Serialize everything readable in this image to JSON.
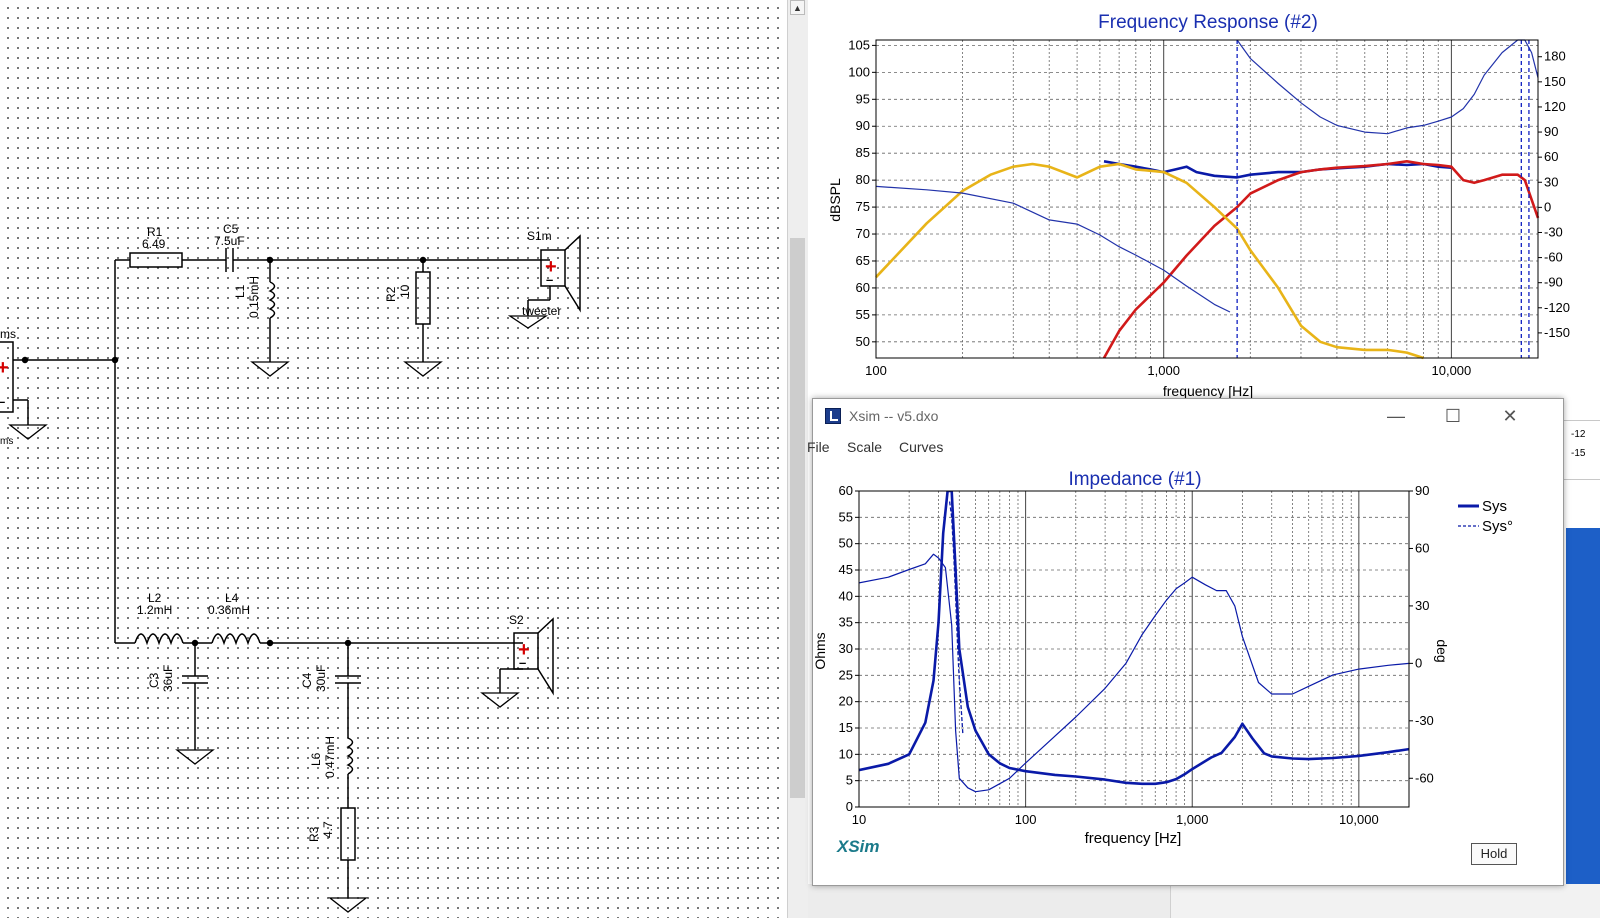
{
  "schematic": {
    "components": {
      "r1": {
        "ref": "R1",
        "value": "6.49"
      },
      "c5": {
        "ref": "C5",
        "value": "7.5uF"
      },
      "l1": {
        "ref": "L1",
        "value": "0.15mH"
      },
      "r2": {
        "ref": "R2",
        "value": "10"
      },
      "s1m": {
        "ref": "S1m",
        "label": "tweeter"
      },
      "l2": {
        "ref": "L2",
        "value": "1.2mH"
      },
      "l4": {
        "ref": "L4",
        "value": "0.36mH"
      },
      "c3": {
        "ref": "C3",
        "value": "36uF"
      },
      "c4": {
        "ref": "C4",
        "value": "30uF"
      },
      "l6": {
        "ref": "L6",
        "value": "0.47mH"
      },
      "r3": {
        "ref": "R3",
        "value": "4.7"
      },
      "s2": {
        "ref": "S2"
      }
    },
    "source_label_top": "ms",
    "source_label_bottom": "ms",
    "plus_sign": "+",
    "minus_sign": "–"
  },
  "scrollbar": {
    "up_arrow": "▲"
  },
  "frequency_response": {
    "title": "Frequency Response (#2)",
    "ylabel": "dBSPL",
    "xlabel": "frequency [Hz]",
    "y_ticks": [
      "105",
      "100",
      "95",
      "90",
      "85",
      "80",
      "75",
      "70",
      "65",
      "60",
      "55",
      "50"
    ],
    "y2_ticks": [
      "180",
      "150",
      "120",
      "90",
      "60",
      "30",
      "0",
      "-30",
      "-60",
      "-90",
      "-120",
      "-150"
    ],
    "x_ticks": [
      "100",
      "1,000",
      "10,000"
    ],
    "colors": {
      "system": "#0a1aa8",
      "tweeter": "#d11a1a",
      "woofer": "#e8b418",
      "phase": "#2233aa"
    }
  },
  "window": {
    "title": "Xsim -- v5.dxo",
    "icon": "xsim-app-icon",
    "minimize_icon": "minimize-icon",
    "maximize_icon": "maximize-icon",
    "close_icon": "close-icon",
    "minimize_glyph": "—",
    "maximize_glyph": "☐",
    "close_glyph": "✕",
    "menu": [
      "File",
      "Scale",
      "Curves"
    ]
  },
  "impedance": {
    "title": "Impedance (#1)",
    "ylabel": "Ohms",
    "y2label": "deg",
    "xlabel": "frequency [Hz]",
    "y_ticks": [
      "60",
      "55",
      "50",
      "45",
      "40",
      "35",
      "30",
      "25",
      "20",
      "15",
      "10",
      "5",
      "0"
    ],
    "y2_ticks": [
      "90",
      "60",
      "30",
      "0",
      "-30",
      "-60"
    ],
    "x_ticks": [
      "10",
      "100",
      "1,000",
      "10,000"
    ],
    "legend": [
      {
        "name": "Sys",
        "style": "solid"
      },
      {
        "name": "Sys°",
        "style": "dashed"
      }
    ],
    "brand": "XSim",
    "hold_button": "Hold"
  },
  "peek_labels": [
    "-12",
    "-15"
  ],
  "chart_data": [
    {
      "type": "line",
      "title": "Frequency Response (#2)",
      "xlabel": "frequency [Hz]",
      "ylabel": "dBSPL",
      "x_scale": "log",
      "xlim": [
        100,
        20000
      ],
      "ylim": [
        47,
        106
      ],
      "y2lim": [
        -180,
        200
      ],
      "grid": true,
      "series": [
        {
          "role": "system",
          "color": "#0a1aa8",
          "x": [
            620,
            700,
            800,
            900,
            1000,
            1100,
            1200,
            1300,
            1500,
            1800,
            2000,
            2500,
            3000,
            3500,
            4000,
            5000,
            6000,
            7000,
            8000,
            9000,
            10000
          ],
          "y": [
            83.5,
            83,
            82.5,
            82,
            81.5,
            82,
            82.5,
            81.5,
            80.8,
            80.5,
            81,
            81.5,
            81.5,
            82,
            82.2,
            82.5,
            83,
            82.8,
            83,
            82.5,
            82.3
          ]
        },
        {
          "role": "tweeter",
          "color": "#d11a1a",
          "x": [
            620,
            700,
            800,
            1000,
            1200,
            1500,
            1800,
            2000,
            2500,
            3000,
            3500,
            4000,
            5000,
            6000,
            7000,
            8000,
            9000,
            10000,
            11000,
            12000,
            13000,
            15000,
            17000,
            18000,
            20000
          ],
          "y": [
            47,
            52,
            56,
            61,
            66,
            71.5,
            75,
            77.5,
            80,
            81.5,
            82,
            82.3,
            82.6,
            83,
            83.5,
            83,
            82.8,
            82.5,
            80,
            79.5,
            80,
            81,
            81,
            80,
            73
          ]
        },
        {
          "role": "woofer",
          "color": "#e8b418",
          "x": [
            100,
            150,
            200,
            250,
            300,
            350,
            400,
            500,
            600,
            700,
            800,
            1000,
            1200,
            1500,
            1800,
            2000,
            2500,
            3000,
            3500,
            4000,
            5000,
            6000,
            7000,
            8000
          ],
          "y": [
            62,
            72,
            78,
            81,
            82.5,
            83,
            82.5,
            80.5,
            82.5,
            83,
            82,
            81.5,
            79.5,
            75,
            71,
            67,
            60,
            53,
            50,
            49,
            48.5,
            48.5,
            48,
            46.5
          ]
        },
        {
          "role": "phase",
          "style": "thin",
          "color": "#2233aa",
          "x": [
            100,
            150,
            200,
            300,
            400,
            500,
            600,
            700,
            800,
            1000,
            1200,
            1500,
            1700
          ],
          "y2": [
            25,
            21,
            17,
            5,
            -15,
            -20,
            -33,
            -47,
            -57,
            -75,
            -94,
            -116,
            -125
          ]
        },
        {
          "role": "phase",
          "style": "thin",
          "color": "#2233aa",
          "x": [
            1800,
            2000,
            2500,
            3000,
            3500,
            4000,
            5000,
            6000,
            7000,
            8000,
            9000,
            10000,
            11000,
            12000,
            13000,
            15000,
            17000,
            18000,
            19000,
            20000
          ],
          "y2": [
            200,
            178,
            148,
            125,
            108,
            98,
            90,
            88,
            95,
            98,
            103,
            108,
            118,
            135,
            158,
            185,
            200,
            200,
            185,
            155
          ]
        }
      ]
    },
    {
      "type": "line",
      "title": "Impedance (#1)",
      "xlabel": "frequency [Hz]",
      "ylabel": "Ohms",
      "y2label": "deg",
      "x_scale": "log",
      "xlim": [
        10,
        20000
      ],
      "ylim": [
        0,
        60
      ],
      "y2lim": [
        -75,
        90
      ],
      "grid": true,
      "series": [
        {
          "name": "Sys",
          "style": "solid",
          "x": [
            10,
            15,
            20,
            25,
            28,
            30,
            32,
            34,
            36,
            38,
            40,
            45,
            50,
            60,
            70,
            80,
            100,
            150,
            200,
            300,
            400,
            500,
            600,
            700,
            800,
            900,
            1000,
            1300,
            1500,
            1800,
            2000,
            2300,
            2700,
            3000,
            4000,
            5000,
            7000,
            10000,
            15000,
            20000
          ],
          "y": [
            7,
            8.2,
            10,
            16,
            24,
            35,
            52,
            65,
            63,
            45,
            30,
            19,
            14.5,
            10,
            8.3,
            7.4,
            6.8,
            6.1,
            5.8,
            5.2,
            4.6,
            4.4,
            4.4,
            4.7,
            5.3,
            6.2,
            7.2,
            9.4,
            10.3,
            13.3,
            15.8,
            13,
            10.2,
            9.6,
            9.2,
            9.1,
            9.3,
            9.7,
            10.4,
            11
          ]
        },
        {
          "name": "Sys°",
          "style": "dashed",
          "x": [
            35,
            36,
            37,
            38,
            39,
            40,
            41,
            42
          ],
          "y": [
            58,
            55,
            48,
            40,
            31,
            24,
            19,
            14
          ]
        },
        {
          "name": "Sys°",
          "style": "thin",
          "x": [
            10,
            15,
            20,
            25,
            28,
            30,
            33,
            36,
            38,
            40,
            45,
            50,
            60,
            80,
            100,
            150,
            200,
            300,
            400,
            500,
            600,
            700,
            800,
            900,
            1000,
            1200,
            1400,
            1600,
            1800,
            2000,
            2500,
            3000,
            4000,
            5000,
            7000,
            10000,
            15000,
            20000
          ],
          "y2": [
            42,
            45,
            49,
            52,
            57,
            55,
            50,
            20,
            -35,
            -60,
            -65,
            -67,
            -66,
            -60,
            -52,
            -38,
            -28,
            -13,
            0,
            15,
            25,
            33,
            39,
            42,
            45,
            41,
            38,
            38,
            30,
            14,
            -10,
            -16,
            -16,
            -12,
            -6,
            -3,
            -1,
            0
          ]
        }
      ]
    }
  ]
}
